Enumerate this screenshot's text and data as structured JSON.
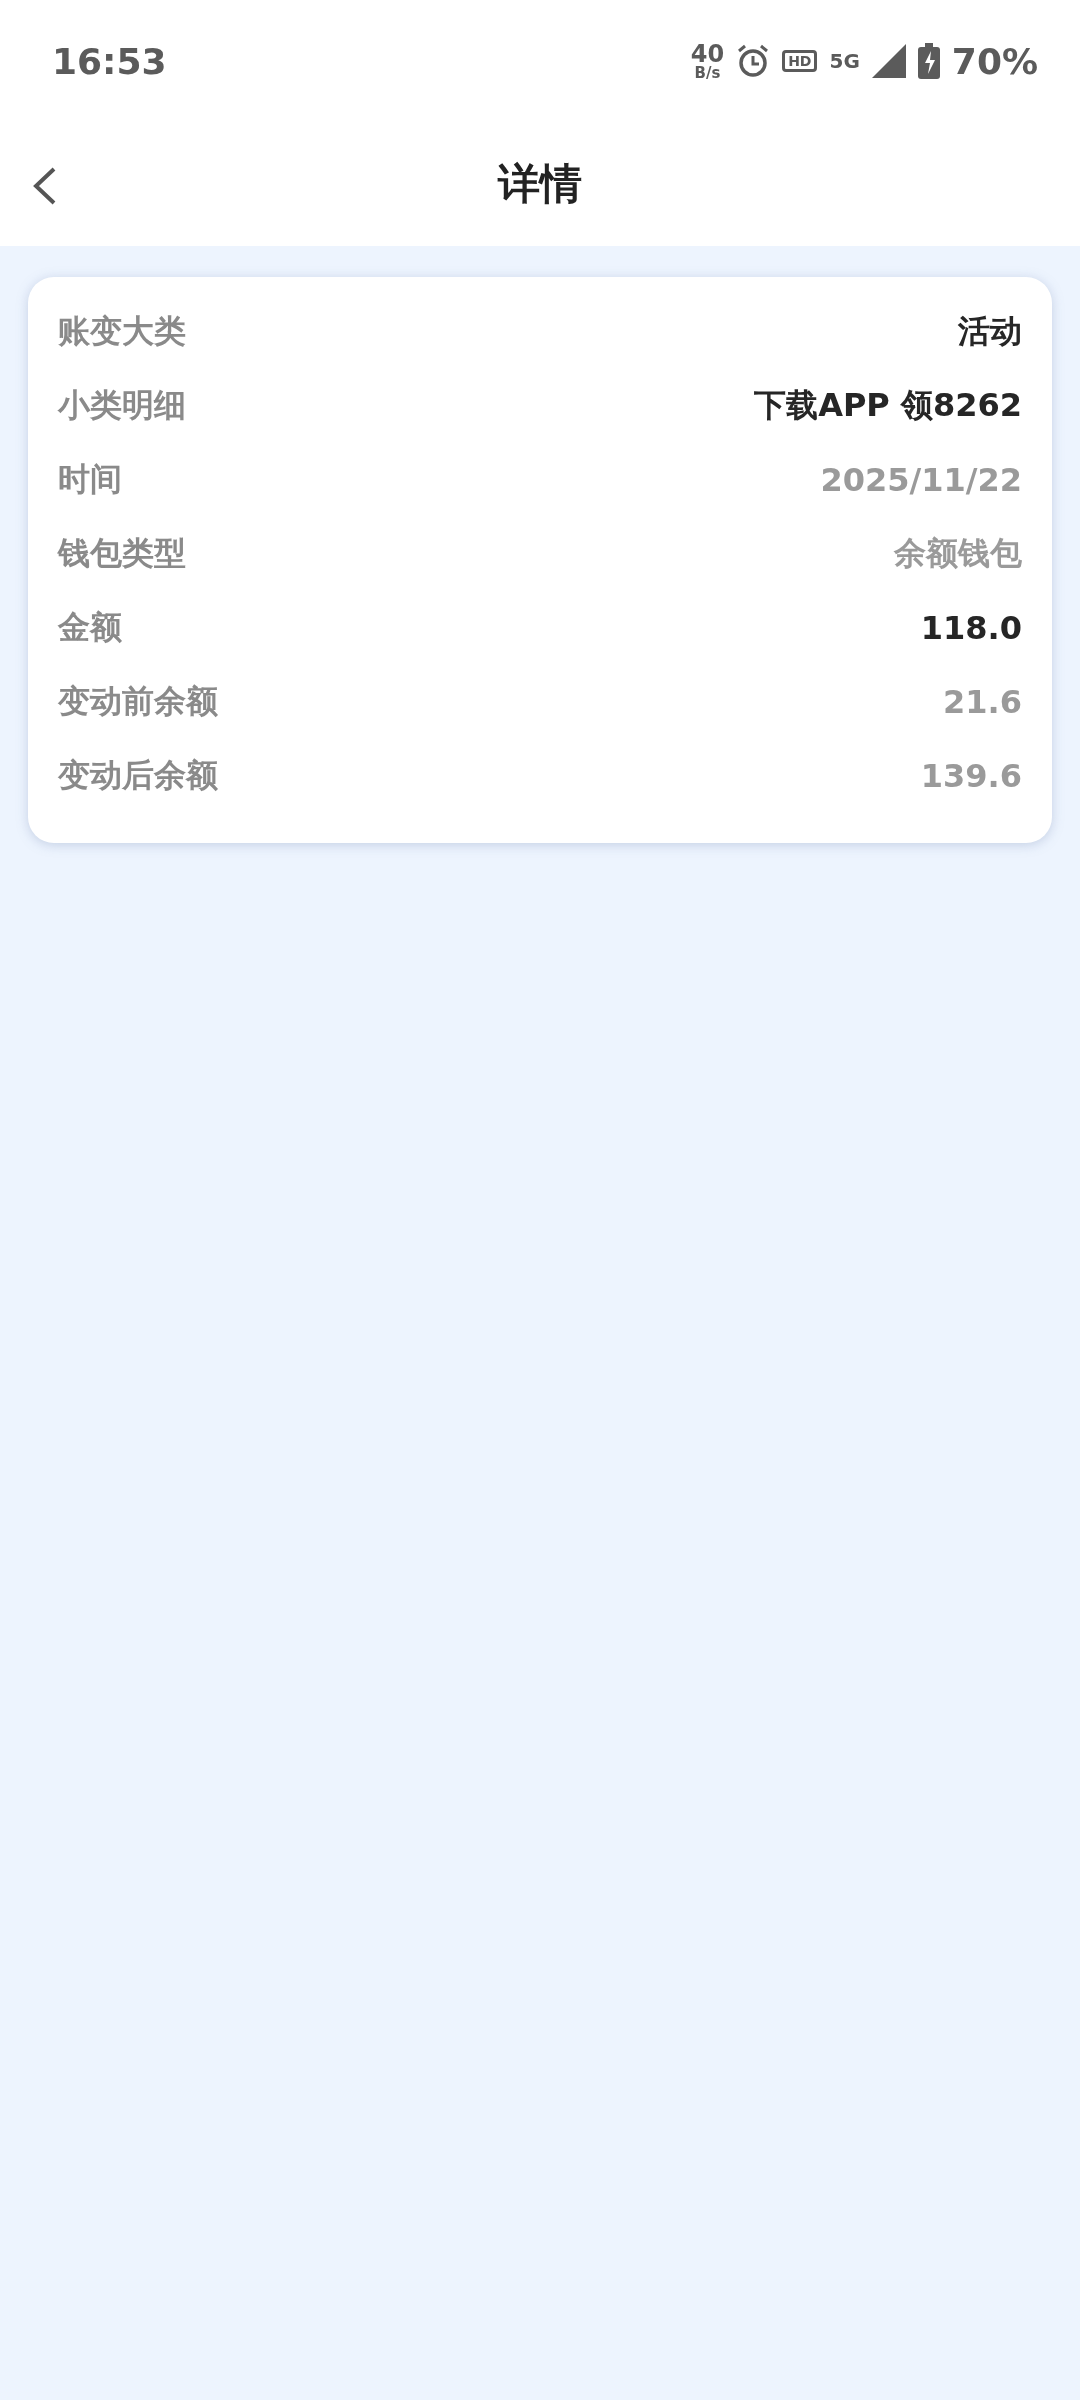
{
  "status_bar": {
    "time": "16:53",
    "speed": "40",
    "speed_unit": "B/s",
    "hd": "HD",
    "network": "5G",
    "battery": "70%"
  },
  "header": {
    "title": "详情"
  },
  "details": [
    {
      "label": "账变大类",
      "value": "活动",
      "kind": "strong"
    },
    {
      "label": "小类明细",
      "value": "下载APP 领8262",
      "kind": "strong"
    },
    {
      "label": "时间",
      "value": "2025/11/22",
      "kind": "muted"
    },
    {
      "label": "钱包类型",
      "value": "余额钱包",
      "kind": "muted"
    },
    {
      "label": "金额",
      "value": "118.0",
      "kind": "strong"
    },
    {
      "label": "变动前余额",
      "value": "21.6",
      "kind": "muted"
    },
    {
      "label": "变动后余额",
      "value": "139.6",
      "kind": "muted"
    }
  ]
}
